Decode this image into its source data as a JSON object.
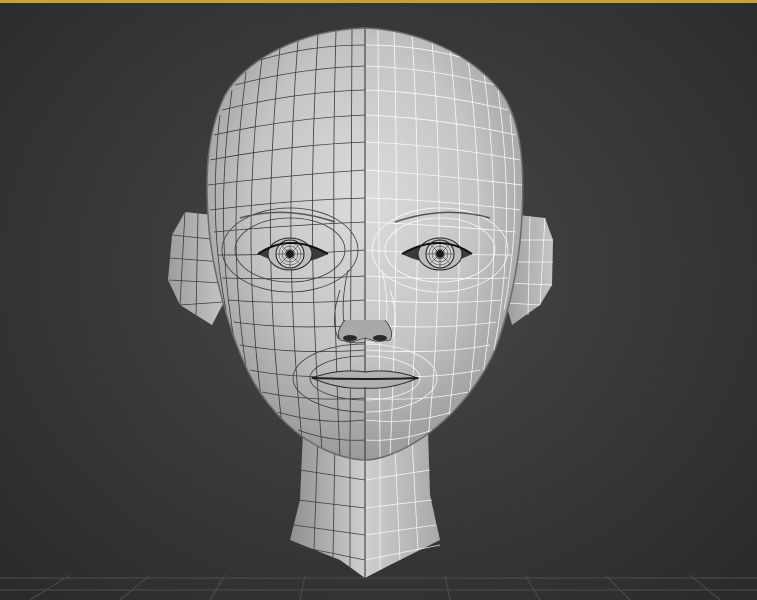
{
  "app": {
    "viewport_label": ""
  },
  "colors": {
    "frame_accent": "#c8a233",
    "background": "#3a3a3a",
    "mesh_fill": "#c9c9c9",
    "wire_dark": "#3a3a3a",
    "wire_light": "#ffffff"
  },
  "scene": {
    "object": "head-mesh",
    "view": "front",
    "grid_visible": true
  }
}
